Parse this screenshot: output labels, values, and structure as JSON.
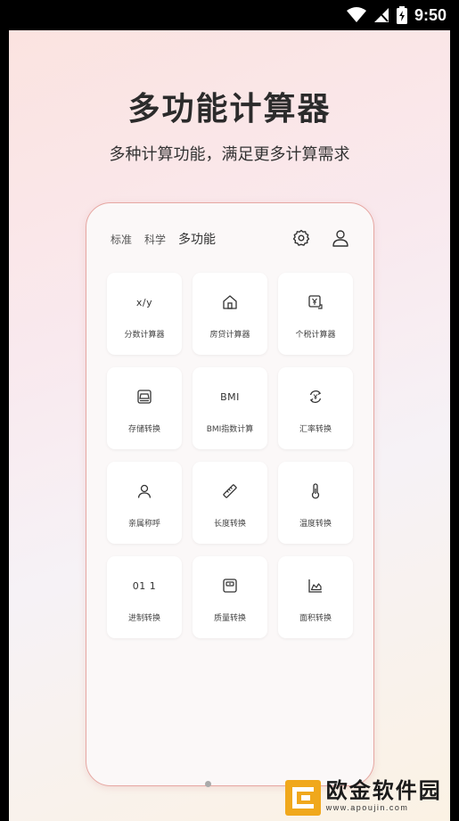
{
  "status_bar": {
    "time": "9:50"
  },
  "promo": {
    "title": "多功能计算器",
    "subtitle": "多种计算功能，满足更多计算需求"
  },
  "calculator": {
    "tabs": [
      {
        "label": "标准",
        "active": false
      },
      {
        "label": "科学",
        "active": false
      },
      {
        "label": "多功能",
        "active": true
      }
    ],
    "tiles": [
      {
        "label": "分数计算器",
        "icon": "fraction-icon",
        "icon_text": "x/y"
      },
      {
        "label": "房贷计算器",
        "icon": "house-icon"
      },
      {
        "label": "个税计算器",
        "icon": "tax-icon"
      },
      {
        "label": "存储转换",
        "icon": "storage-icon"
      },
      {
        "label": "BMI指数计算",
        "icon": "bmi-icon",
        "icon_text": "BMI"
      },
      {
        "label": "汇率转换",
        "icon": "exchange-icon"
      },
      {
        "label": "亲属称呼",
        "icon": "person-icon"
      },
      {
        "label": "长度转换",
        "icon": "ruler-icon"
      },
      {
        "label": "温度转换",
        "icon": "thermometer-icon"
      },
      {
        "label": "进制转换",
        "icon": "binary-icon",
        "icon_text": "01 1"
      },
      {
        "label": "质量转换",
        "icon": "scale-icon"
      },
      {
        "label": "面积转换",
        "icon": "area-chart-icon"
      }
    ]
  },
  "watermark": {
    "name": "欧金软件园",
    "url": "www.apoujin.com"
  }
}
